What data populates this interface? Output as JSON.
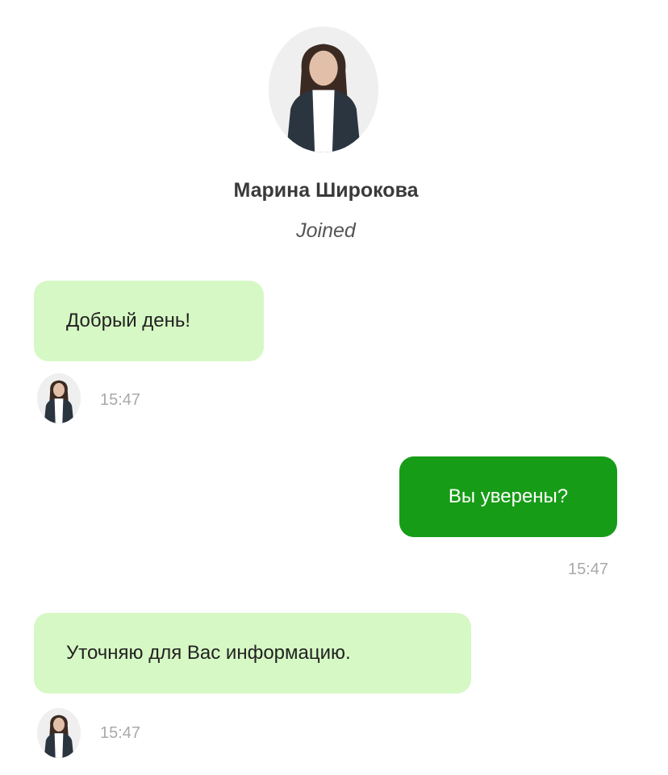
{
  "contact": {
    "name": "Марина Широкова",
    "status": "Joined"
  },
  "messages": [
    {
      "direction": "incoming",
      "text": "Добрый день!",
      "time": "15:47"
    },
    {
      "direction": "outgoing",
      "text": "Вы уверены?",
      "time": "15:47"
    },
    {
      "direction": "incoming",
      "text": "Уточняю для Вас информацию.",
      "time": "15:47"
    }
  ],
  "colors": {
    "incoming_bubble": "#d6f8c4",
    "outgoing_bubble": "#179c17",
    "timestamp": "#a9a9a9"
  }
}
